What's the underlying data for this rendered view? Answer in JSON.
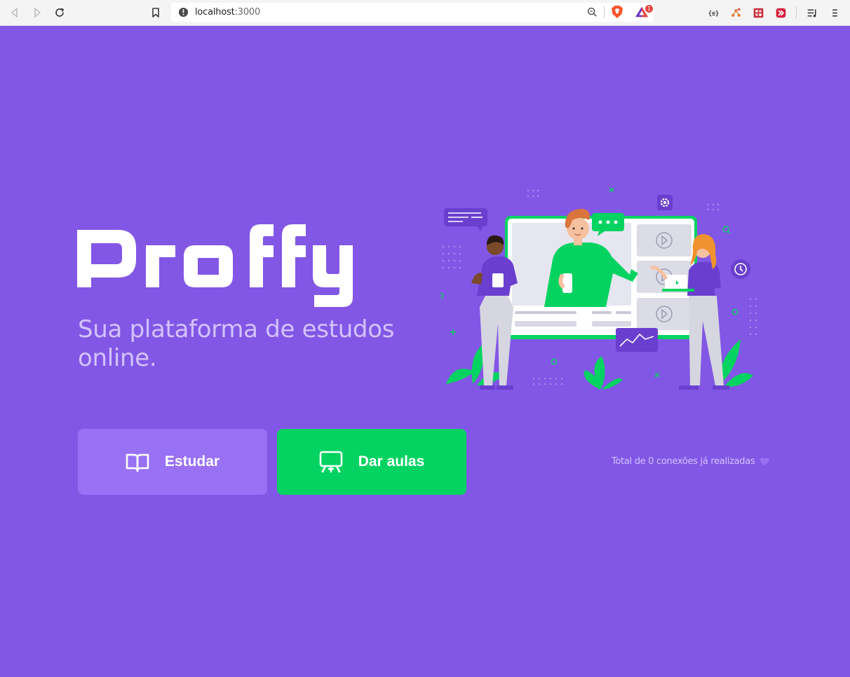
{
  "browser": {
    "url_host": "localhost",
    "url_port": ":3000",
    "rewards_badge": "1",
    "extension_icons": [
      "json-viewer-icon",
      "network-extension-icon",
      "wappalyzer-icon",
      "redux-devtools-icon"
    ]
  },
  "page": {
    "logo_text": "Proffy",
    "tagline": "Sua plataforma de estudos online.",
    "buttons": {
      "study_label": "Estudar",
      "teach_label": "Dar aulas"
    },
    "connections_text": "Total de 0 conexões já realizadas"
  },
  "colors": {
    "background": "#8257e5",
    "study_button": "#9871f5",
    "teach_button": "#04d361",
    "tagline": "#d4c2ff"
  }
}
